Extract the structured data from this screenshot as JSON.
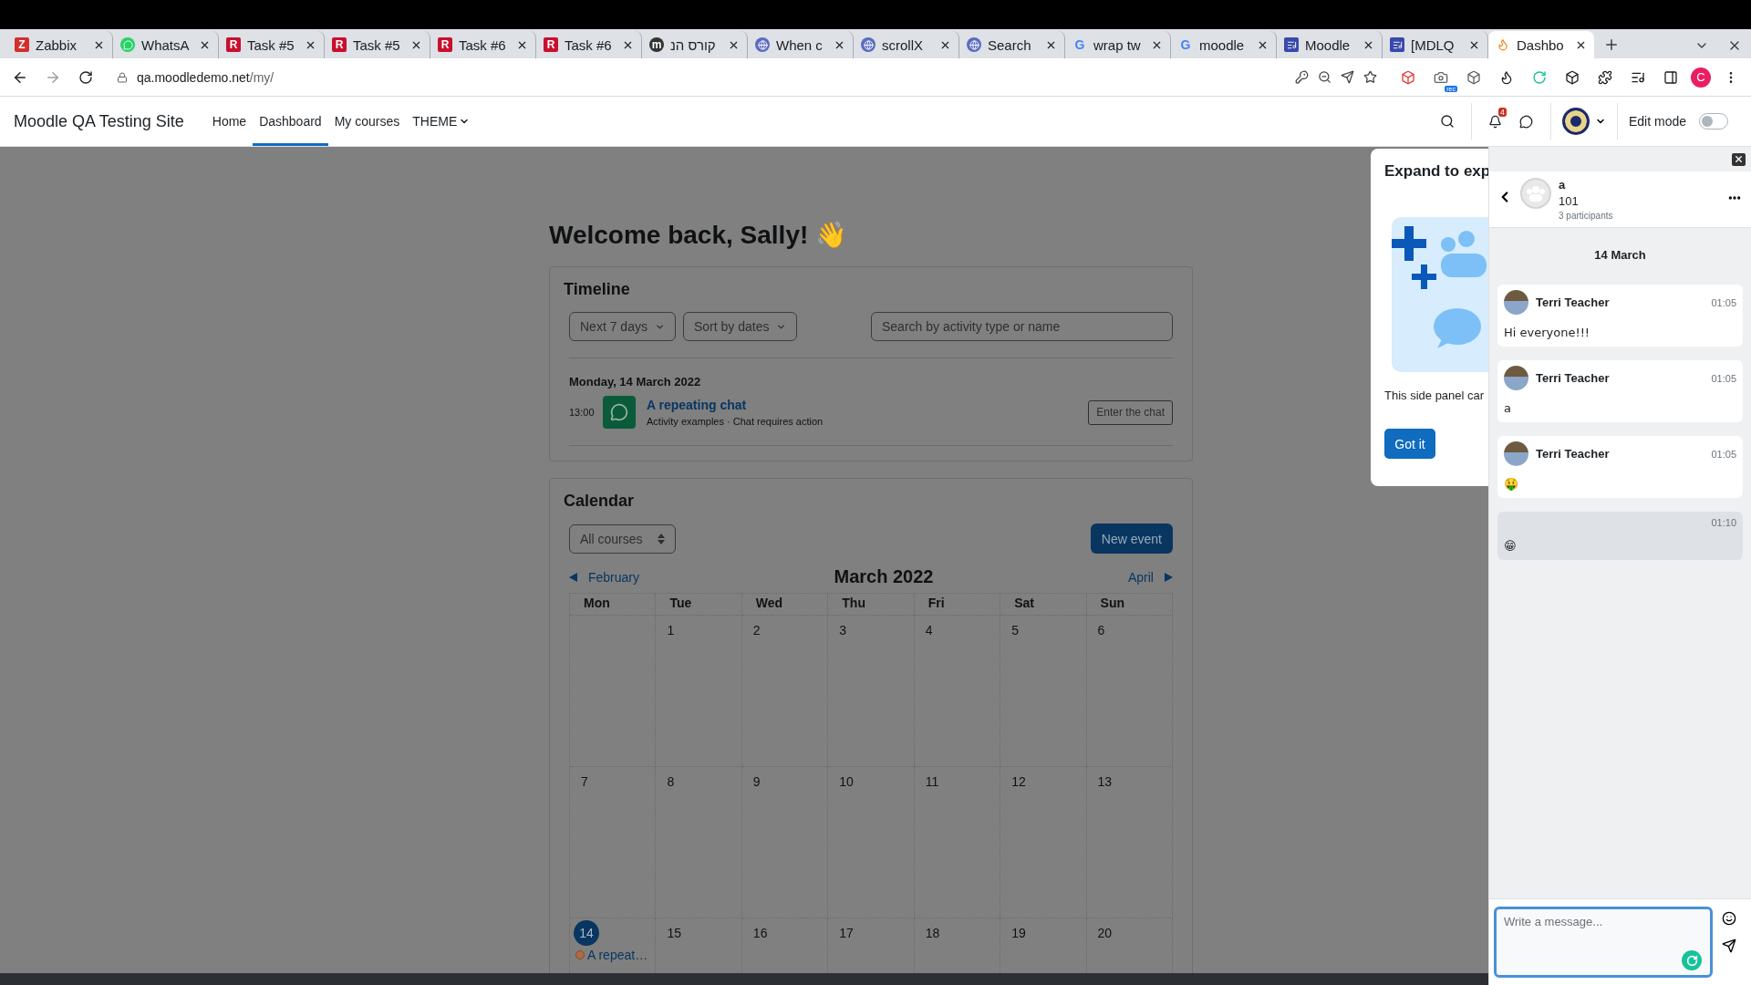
{
  "browser": {
    "tabs": [
      {
        "label": "Zabbix",
        "kind": "letter",
        "letter": "Z",
        "selected": false
      },
      {
        "label": "WhatsA",
        "kind": "whatsapp",
        "selected": false
      },
      {
        "label": "Task #5",
        "kind": "letter",
        "letter": "R",
        "selected": false
      },
      {
        "label": "Task #5",
        "kind": "letter",
        "letter": "R",
        "selected": false
      },
      {
        "label": "Task #6",
        "kind": "letter",
        "letter": "R",
        "selected": false
      },
      {
        "label": "Task #6",
        "kind": "letter",
        "letter": "R",
        "selected": false
      },
      {
        "label": "קורס הנ",
        "kind": "round-letter",
        "letter": "m",
        "selected": false
      },
      {
        "label": "When c",
        "kind": "globe",
        "selected": false
      },
      {
        "label": "scrollX",
        "kind": "globe",
        "selected": false
      },
      {
        "label": "Search",
        "kind": "globe",
        "selected": false
      },
      {
        "label": "wrap tw",
        "kind": "google",
        "letter": "G",
        "selected": false
      },
      {
        "label": "moodle",
        "kind": "google",
        "letter": "G",
        "selected": false
      },
      {
        "label": "Moodle",
        "kind": "tracker",
        "selected": false
      },
      {
        "label": "[MDLQ",
        "kind": "tracker",
        "selected": false
      },
      {
        "label": "Dashbo",
        "kind": "moodle",
        "selected": true
      }
    ],
    "url": {
      "host": "qa.moodledemo.net",
      "path": "/my/"
    },
    "extension_badge": "rec",
    "profile_letter": "C"
  },
  "navbar": {
    "site_name": "Moodle QA Testing Site",
    "items": [
      {
        "label": "Home",
        "selected": false,
        "kind": "link"
      },
      {
        "label": "Dashboard",
        "selected": true,
        "kind": "link"
      },
      {
        "label": "My courses",
        "selected": false,
        "kind": "link"
      },
      {
        "label": "THEME",
        "selected": false,
        "kind": "menu"
      }
    ],
    "notification_count": "4",
    "edit_mode": {
      "label": "Edit mode",
      "on": false
    }
  },
  "welcome": "Welcome back, Sally! 👋",
  "timeline": {
    "title": "Timeline",
    "filters": [
      "Next 7 days",
      "Sort by dates"
    ],
    "search_placeholder": "Search by activity type or name",
    "date_heading": "Monday, 14 March 2022",
    "events": [
      {
        "time": "13:00",
        "title": "A repeating chat",
        "meta": "Activity examples · Chat requires action",
        "action": "Enter the chat"
      }
    ]
  },
  "calendar": {
    "title": "Calendar",
    "course_select": "All courses",
    "new_event": "New event",
    "prev": "February",
    "month": "March 2022",
    "next": "April",
    "weekdays": [
      "Mon",
      "Tue",
      "Wed",
      "Thu",
      "Fri",
      "Sat",
      "Sun"
    ],
    "weeks": [
      [
        {
          "kind": "empty"
        },
        {
          "kind": "day",
          "day": "1",
          "today": false
        },
        {
          "kind": "day",
          "day": "2",
          "today": false
        },
        {
          "kind": "day",
          "day": "3",
          "today": false
        },
        {
          "kind": "day",
          "day": "4",
          "today": false
        },
        {
          "kind": "day",
          "day": "5",
          "today": false
        },
        {
          "kind": "day",
          "day": "6",
          "today": false
        }
      ],
      [
        {
          "kind": "day",
          "day": "7",
          "today": false
        },
        {
          "kind": "day",
          "day": "8",
          "today": false
        },
        {
          "kind": "day",
          "day": "9",
          "today": false
        },
        {
          "kind": "day",
          "day": "10",
          "today": false
        },
        {
          "kind": "day",
          "day": "11",
          "today": false
        },
        {
          "kind": "day",
          "day": "12",
          "today": false
        },
        {
          "kind": "day",
          "day": "13",
          "today": false
        }
      ],
      [
        {
          "kind": "day",
          "day": "14",
          "today": true,
          "events": [
            "A repeat…"
          ]
        },
        {
          "kind": "day",
          "day": "15",
          "today": false
        },
        {
          "kind": "day",
          "day": "16",
          "today": false
        },
        {
          "kind": "day",
          "day": "17",
          "today": false
        },
        {
          "kind": "day",
          "day": "18",
          "today": false
        },
        {
          "kind": "day",
          "day": "19",
          "today": false
        },
        {
          "kind": "day",
          "day": "20",
          "today": false
        }
      ]
    ]
  },
  "popover": {
    "title": "Expand to exp",
    "text": "This side panel car",
    "button": "Got it"
  },
  "drawer": {
    "conversation": {
      "name": "a",
      "subtitle": "101",
      "participants": "3 participants"
    },
    "date": "14 March",
    "messages": [
      {
        "own": false,
        "sender": "Terri Teacher",
        "time": "01:05",
        "text": "Hi everyone!!!"
      },
      {
        "own": false,
        "sender": "Terri Teacher",
        "time": "01:05",
        "text": "a"
      },
      {
        "own": false,
        "sender": "Terri Teacher",
        "time": "01:05",
        "text": "🤑"
      },
      {
        "own": true,
        "time": "01:10",
        "text": "😁"
      }
    ],
    "compose_placeholder": "Write a message..."
  }
}
